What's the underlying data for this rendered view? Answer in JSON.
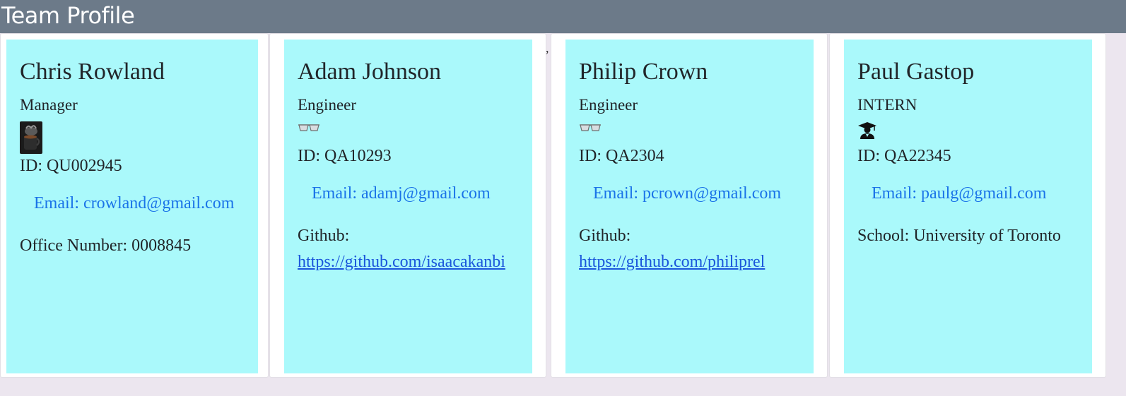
{
  "header": {
    "title": "Team Profile"
  },
  "separator": ",",
  "members": [
    {
      "name": "Chris Rowland",
      "role": "Manager",
      "icon": "coffee-mug-icon",
      "id_text": "ID: QU002945",
      "email_text": "Email: crowland@gmail.com",
      "extra_label": "Office Number: 0008845"
    },
    {
      "name": "Adam Johnson",
      "role": "Engineer",
      "icon": "glasses-icon",
      "id_text": "ID: QA10293",
      "email_text": "Email: adamj@gmail.com",
      "extra_label": "Github:",
      "extra_link": "https://github.com/isaacakanbi"
    },
    {
      "name": "Philip Crown",
      "role": "Engineer",
      "icon": "glasses-icon",
      "id_text": "ID: QA2304",
      "email_text": "Email: pcrown@gmail.com",
      "extra_label": "Github:",
      "extra_link": "https://github.com/philiprel"
    },
    {
      "name": "Paul Gastop",
      "role": "INTERN",
      "icon": "graduate-icon",
      "id_text": "ID: QA22345",
      "email_text": "Email: paulg@gmail.com",
      "extra_label": "School: University of Toronto"
    }
  ]
}
